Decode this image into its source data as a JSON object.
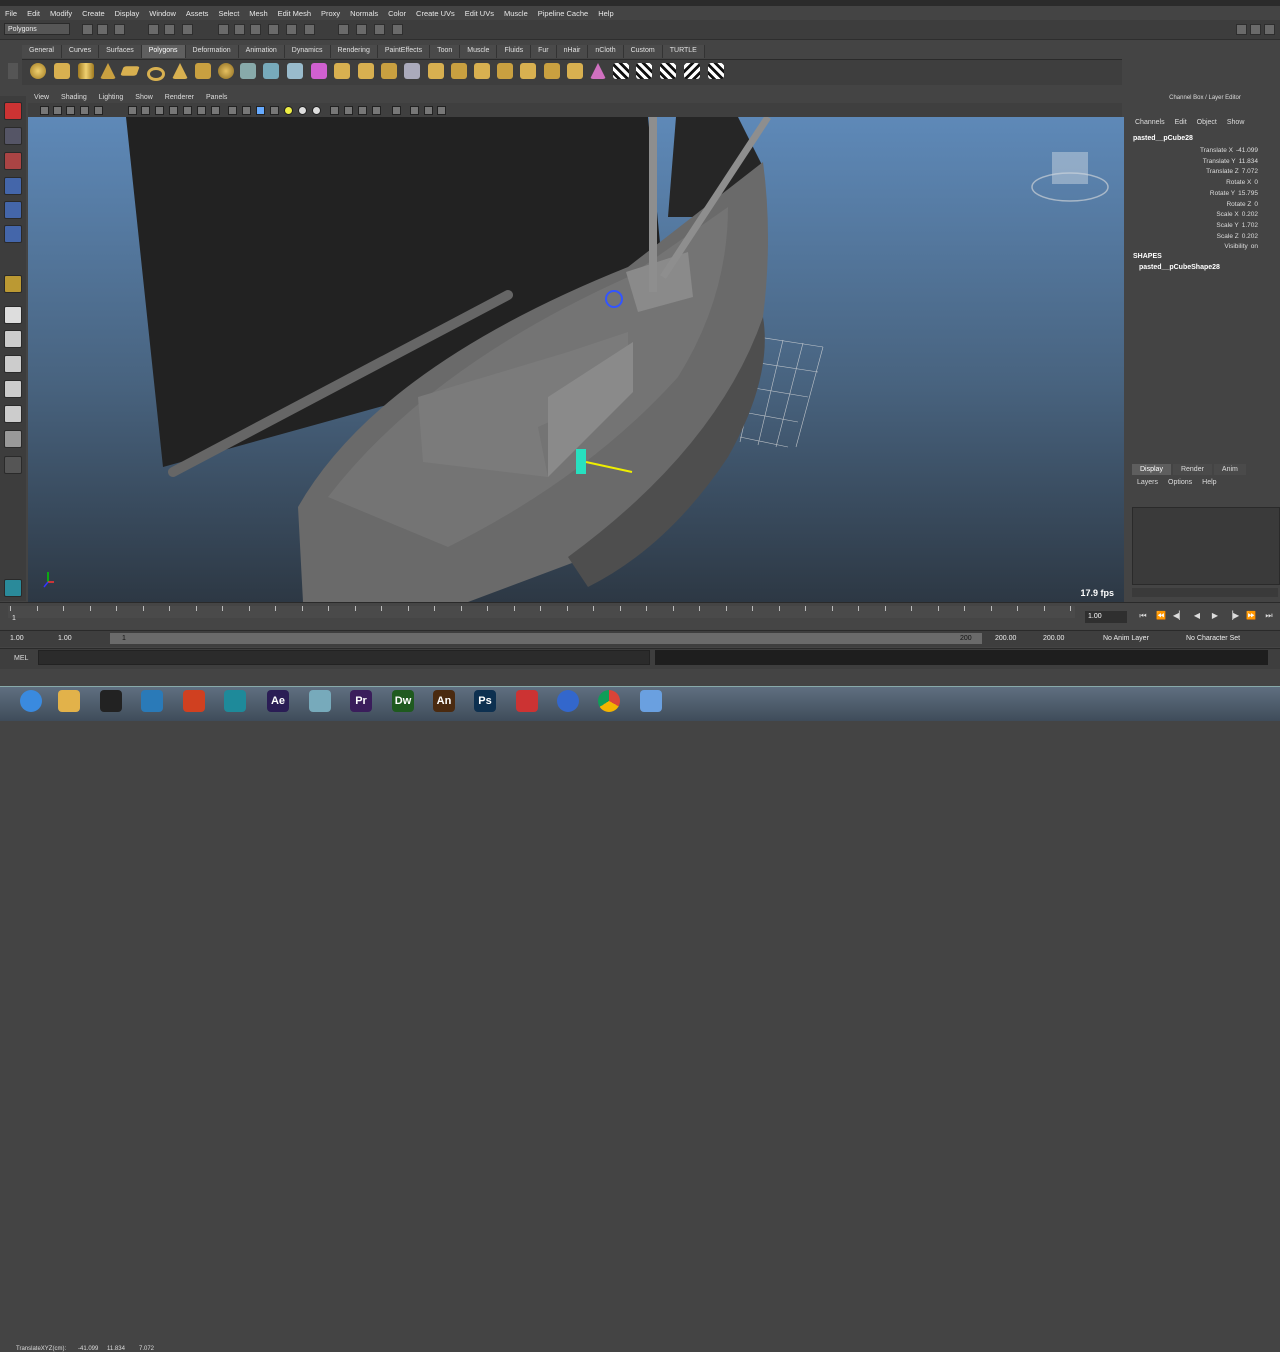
{
  "menubar": [
    "File",
    "Edit",
    "Modify",
    "Create",
    "Display",
    "Window",
    "Assets",
    "Select",
    "Mesh",
    "Edit Mesh",
    "Proxy",
    "Normals",
    "Color",
    "Create UVs",
    "Edit UVs",
    "Muscle",
    "Pipeline Cache",
    "Help"
  ],
  "statusline": {
    "mode": "Polygons"
  },
  "shelf": {
    "tabs": [
      "General",
      "Curves",
      "Surfaces",
      "Polygons",
      "Deformation",
      "Animation",
      "Dynamics",
      "Rendering",
      "PaintEffects",
      "Toon",
      "Muscle",
      "Fluids",
      "Fur",
      "nHair",
      "nCloth",
      "Custom",
      "TURTLE"
    ],
    "active_tab": "Polygons"
  },
  "panel": {
    "menu": [
      "View",
      "Shading",
      "Lighting",
      "Show",
      "Renderer",
      "Panels"
    ],
    "fps": "17.9 fps"
  },
  "channel_box": {
    "title": "Channel Box / Layer Editor",
    "menu": [
      "Channels",
      "Edit",
      "Object",
      "Show"
    ],
    "object_name": "pasted__pCube28",
    "attributes": [
      {
        "name": "Translate X",
        "value": "-41.099"
      },
      {
        "name": "Translate Y",
        "value": "11.834"
      },
      {
        "name": "Translate Z",
        "value": "7.072"
      },
      {
        "name": "Rotate X",
        "value": "0"
      },
      {
        "name": "Rotate Y",
        "value": "15.795"
      },
      {
        "name": "Rotate Z",
        "value": "0"
      },
      {
        "name": "Scale X",
        "value": "0.202"
      },
      {
        "name": "Scale Y",
        "value": "1.702"
      },
      {
        "name": "Scale Z",
        "value": "0.202"
      },
      {
        "name": "Visibility",
        "value": "on"
      }
    ],
    "shapes_header": "SHAPES",
    "shape_name": "pasted__pCubeShape28"
  },
  "layer_editor": {
    "tabs": [
      "Display",
      "Render",
      "Anim"
    ],
    "active_tab": "Display",
    "menu": [
      "Layers",
      "Options",
      "Help"
    ]
  },
  "time_slider": {
    "first_frame": "1",
    "current_time": "1.00"
  },
  "range": {
    "start": "1.00",
    "inner_start": "1.00",
    "slider_start": "1",
    "slider_end": "200",
    "inner_end": "200.00",
    "end": "200.00",
    "anim_layer": "No Anim Layer",
    "char_set": "No Character Set"
  },
  "command_line": {
    "label": "MEL"
  },
  "help_line": {
    "label": "TranslateXYZ(cm):",
    "x": "-41.099",
    "y": "11.834",
    "z": "7.072"
  },
  "taskbar": {
    "apps": [
      {
        "name": "Ae",
        "color": "#2a1d55"
      },
      {
        "name": "Pr",
        "color": "#3a1d5b"
      },
      {
        "name": "Dw",
        "color": "#1f5a1f"
      },
      {
        "name": "An",
        "color": "#4a2a10"
      },
      {
        "name": "Ps",
        "color": "#0d3050"
      }
    ]
  }
}
